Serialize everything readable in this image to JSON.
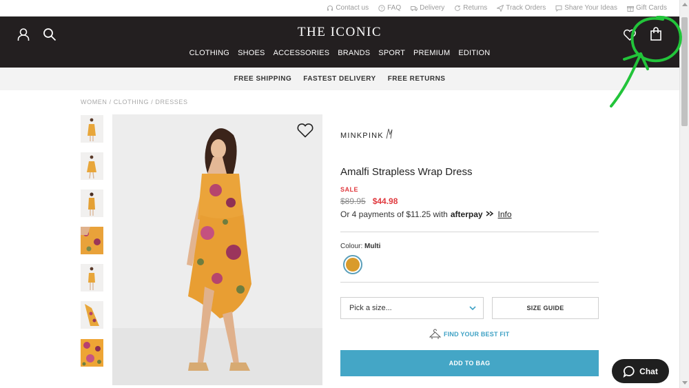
{
  "utility_bar": {
    "items": [
      {
        "label": "Contact us",
        "icon": "headset-icon"
      },
      {
        "label": "FAQ",
        "icon": "question-icon"
      },
      {
        "label": "Delivery",
        "icon": "truck-icon"
      },
      {
        "label": "Returns",
        "icon": "return-icon"
      },
      {
        "label": "Track Orders",
        "icon": "send-icon"
      },
      {
        "label": "Share Your Ideas",
        "icon": "chat-bubble-icon"
      },
      {
        "label": "Gift Cards",
        "icon": "gift-icon"
      }
    ]
  },
  "header": {
    "logo": "THE ICONIC",
    "nav": [
      "CLOTHING",
      "SHOES",
      "ACCESSORIES",
      "BRANDS",
      "SPORT",
      "PREMIUM",
      "EDITION"
    ]
  },
  "promo": [
    "FREE SHIPPING",
    "FASTEST DELIVERY",
    "FREE RETURNS"
  ],
  "breadcrumb": "WOMEN / CLOTHING / DRESSES",
  "product": {
    "brand": "MINKPINK",
    "name": "Amalfi Strapless Wrap Dress",
    "sale_label": "SALE",
    "old_price": "$89.95",
    "new_price": "$44.98",
    "afterpay_text": "Or 4 payments of $11.25 with",
    "afterpay_brand": "afterpay",
    "afterpay_info": "Info",
    "colour_label": "Colour:",
    "colour_value": "Multi",
    "swatch_color": "#d99b2b",
    "size_placeholder": "Pick a size...",
    "size_guide": "SIZE GUIDE",
    "fit_link": "FIND YOUR BEST FIT",
    "add_to_bag": "ADD TO BAG"
  },
  "chat": {
    "label": "Chat"
  },
  "colors": {
    "header_bg": "#231f20",
    "accent": "#44a6c6",
    "sale": "#e0393e",
    "annotation": "#22c43a"
  }
}
